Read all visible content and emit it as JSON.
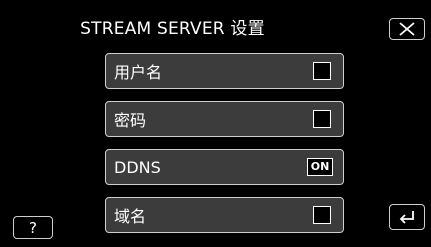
{
  "header": {
    "title": "STREAM SERVER 设置"
  },
  "buttons": {
    "help_label": "?"
  },
  "menu": {
    "items": [
      {
        "label": "用户名",
        "state": "unchecked"
      },
      {
        "label": "密码",
        "state": "unchecked"
      },
      {
        "label": "DDNS",
        "state": "on",
        "badge": "ON"
      },
      {
        "label": "域名",
        "state": "unchecked"
      }
    ]
  },
  "icons": {
    "close": "close-icon",
    "back": "back-return-icon"
  },
  "colors": {
    "background": "#000000",
    "item_background": "#3c3c3c",
    "border": "#cfcfcf",
    "text": "#ffffff"
  }
}
